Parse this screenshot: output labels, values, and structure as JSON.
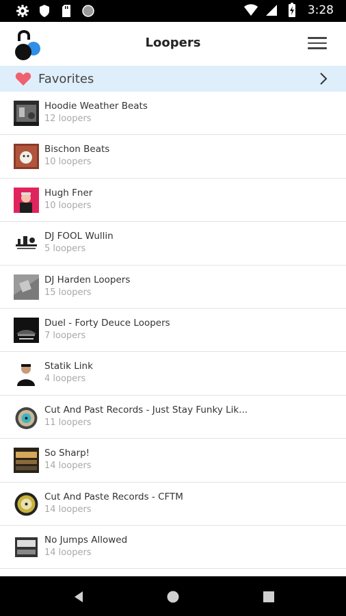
{
  "status_bar": {
    "time": "3:28",
    "icons_left": [
      "gear-icon",
      "shield-icon",
      "sd-card-icon",
      "circle-icon"
    ],
    "icons_right": [
      "wifi-icon",
      "signal-icon",
      "battery-icon"
    ]
  },
  "app_bar": {
    "title": "Loopers"
  },
  "favorites": {
    "label": "Favorites"
  },
  "colors": {
    "favorites_bg": "#deeefb",
    "heart": "#f0606e",
    "logo_blue": "#2f8fe8"
  },
  "items": [
    {
      "title": "Hoodie Weather Beats",
      "count": "12 loopers"
    },
    {
      "title": "Bischon Beats",
      "count": "10 loopers"
    },
    {
      "title": "Hugh Fner",
      "count": "10 loopers"
    },
    {
      "title": "DJ FOOL Wullin",
      "count": "5 loopers"
    },
    {
      "title": "DJ Harden Loopers",
      "count": "15 loopers"
    },
    {
      "title": "Duel - Forty Deuce Loopers",
      "count": "7 loopers"
    },
    {
      "title": "Statik Link",
      "count": "4 loopers"
    },
    {
      "title": "Cut And Past Records - Just Stay Funky Lik...",
      "count": "11 loopers"
    },
    {
      "title": "So Sharp!",
      "count": "14 loopers"
    },
    {
      "title": "Cut And Paste Records - CFTM",
      "count": "14 loopers"
    },
    {
      "title": "No Jumps Allowed",
      "count": "14 loopers"
    }
  ],
  "nav_bar": {
    "buttons": [
      "back-icon",
      "home-icon",
      "recents-icon"
    ]
  }
}
